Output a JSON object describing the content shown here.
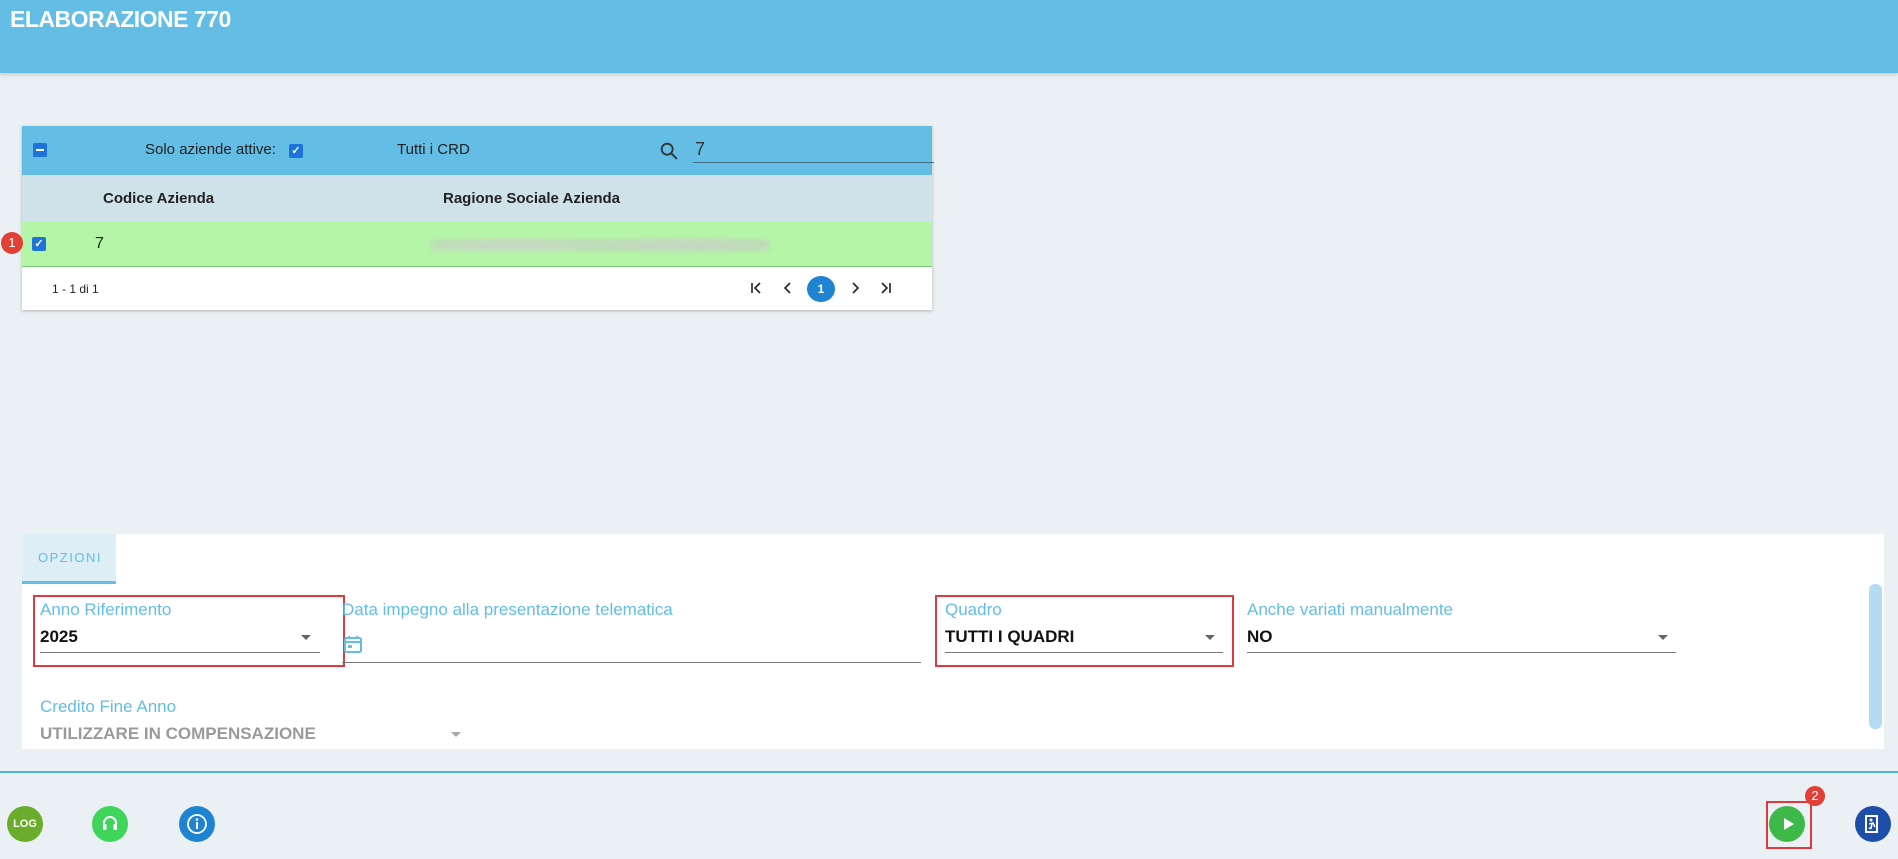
{
  "header": {
    "title": "ELABORAZIONE 770"
  },
  "grid": {
    "toolbar": {
      "solo_attive_label": "Solo aziende attive:",
      "tutti_crd_label": "Tutti i CRD",
      "search_value": "7"
    },
    "columns": [
      "Codice Azienda",
      "Ragione Sociale Azienda"
    ],
    "rows": [
      {
        "codice": "7",
        "ragione_sociale": ""
      }
    ],
    "row_badge": "1",
    "pager": {
      "info": "1 - 1 di 1",
      "current_page": "1"
    }
  },
  "options": {
    "tab_label": "OPZIONI",
    "anno_riferimento": {
      "label": "Anno Riferimento",
      "value": "2025"
    },
    "data_impegno": {
      "label": "Data impegno alla presentazione telematica",
      "value": ""
    },
    "quadro": {
      "label": "Quadro",
      "value": "TUTTI I QUADRI"
    },
    "anche_variati": {
      "label": "Anche variati manualmente",
      "value": "NO"
    },
    "credito_fine_anno": {
      "label": "Credito Fine Anno",
      "value": "UTILIZZARE IN COMPENSAZIONE"
    }
  },
  "footer": {
    "log_label": "LOG",
    "run_badge": "2"
  },
  "colors": {
    "header_bg": "#63bde5",
    "row_selected": "#b5f5a8",
    "highlight_red": "#e0383d",
    "run_green": "#3fb84a",
    "log_green": "#6aac2c",
    "support_green": "#3fd45a",
    "info_blue": "#1e84d2",
    "exit_blue": "#1d4fa8"
  }
}
